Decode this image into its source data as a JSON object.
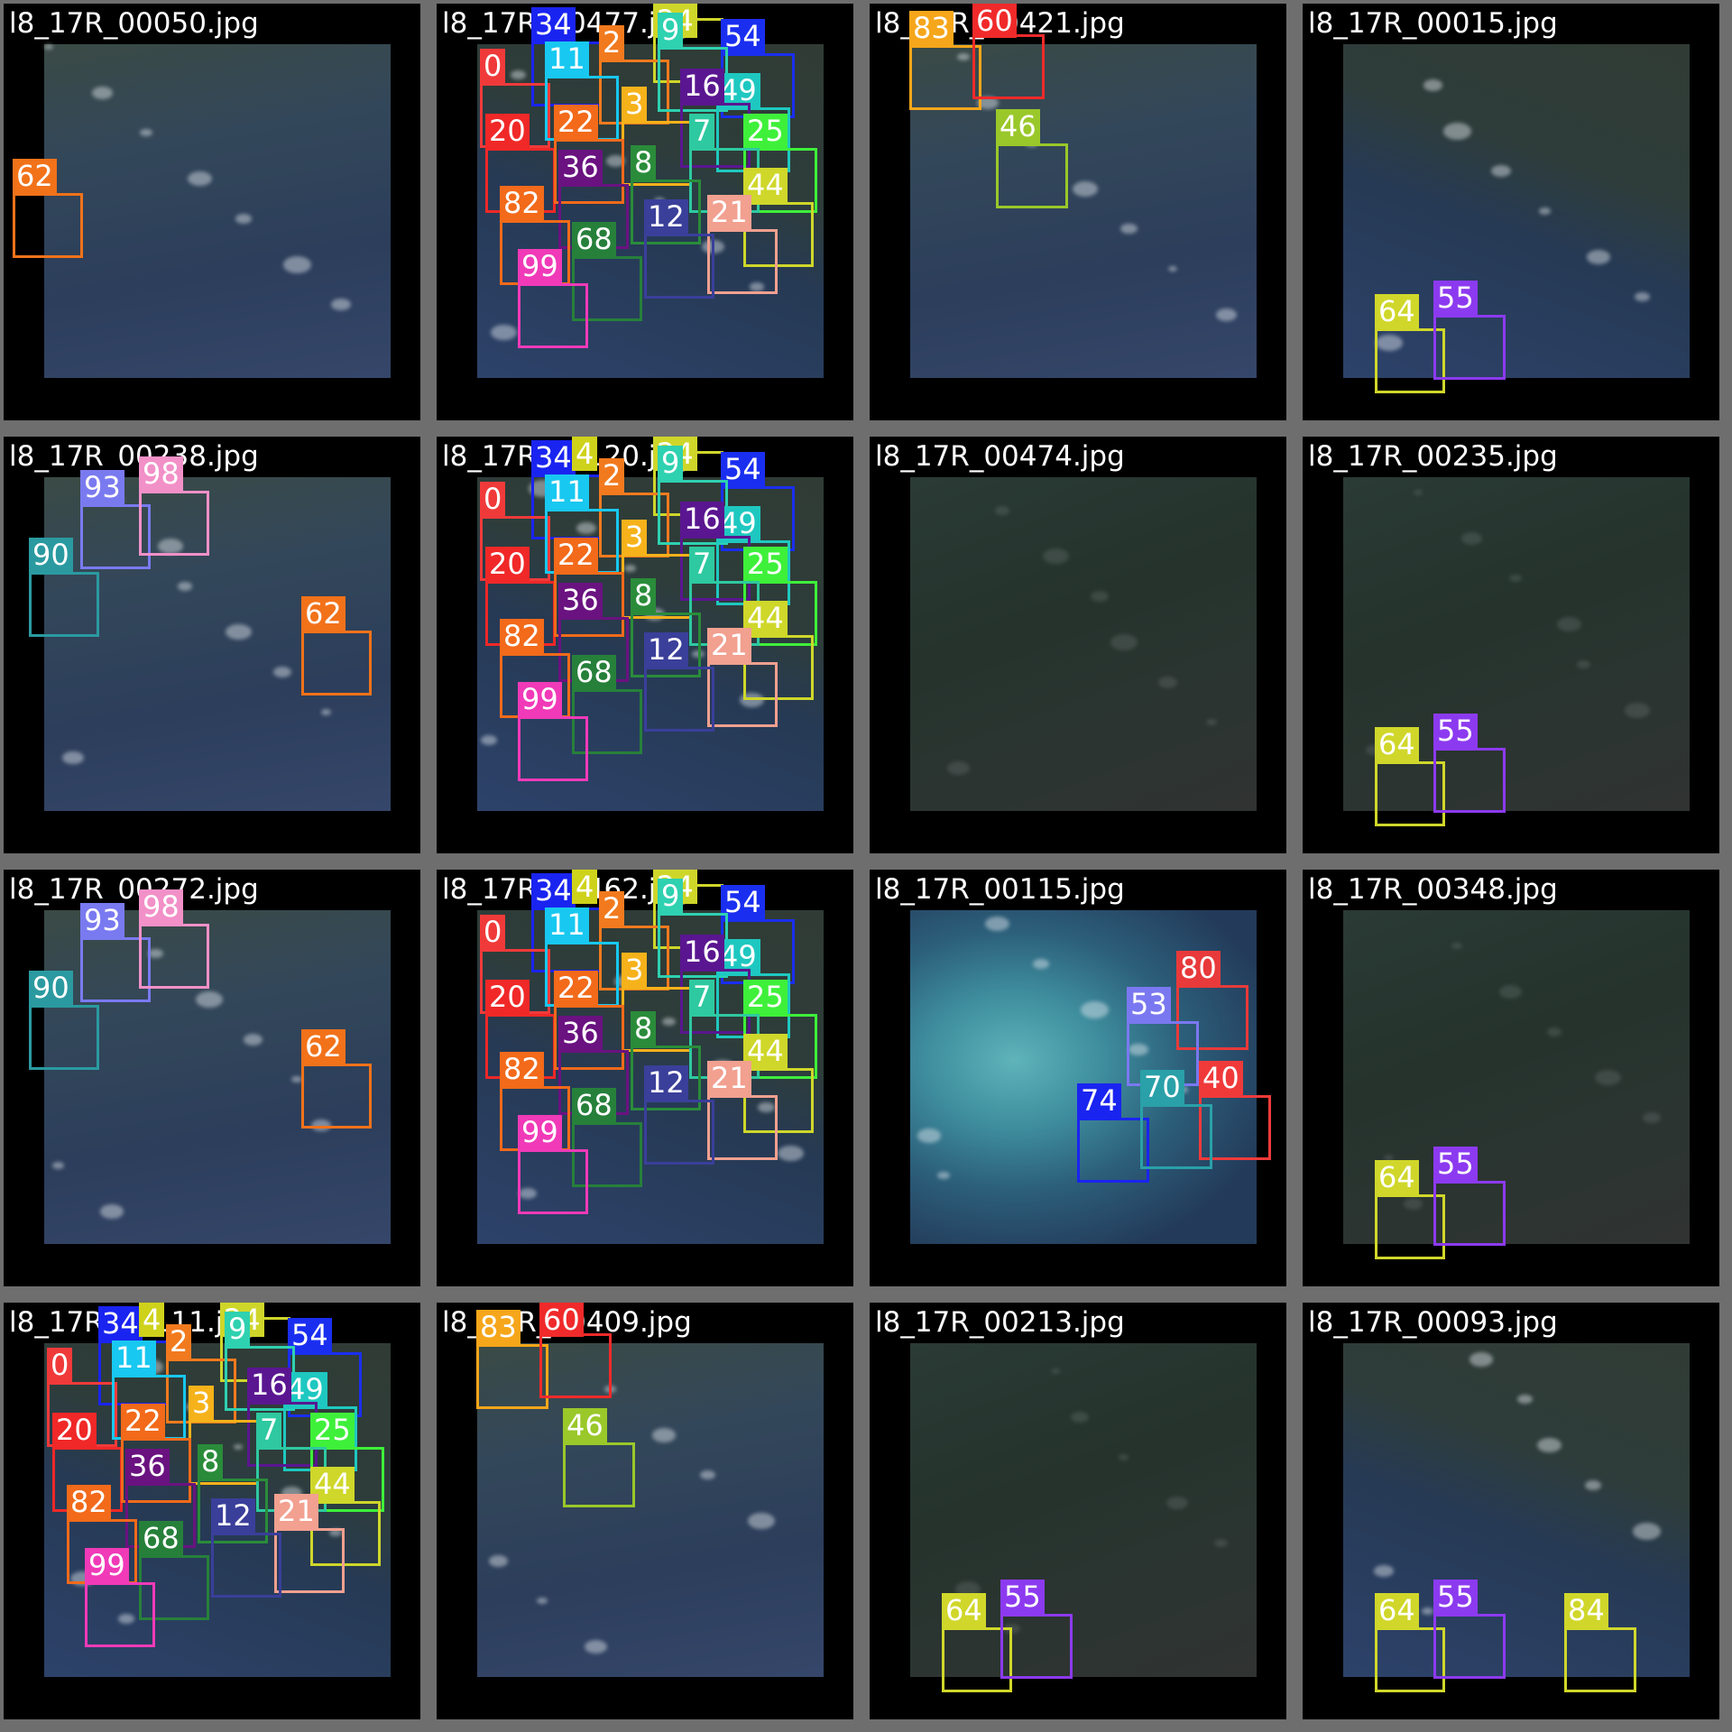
{
  "palette": {
    "0": "#f03a3a",
    "2": "#f27a1e",
    "3": "#f6b21a",
    "4": "#cfd21a",
    "7": "#2ec9a0",
    "8": "#2a8c3a",
    "9": "#2ed1b0",
    "11": "#18c8f0",
    "12": "#3a3f9a",
    "16": "#5a1690",
    "20": "#f02828",
    "21": "#f2a090",
    "22": "#f26a1a",
    "24": "#cfd62a",
    "25": "#3ef03a",
    "34": "#1a24f0",
    "36": "#6a1280",
    "40": "#f03a3a",
    "44": "#cfd72a",
    "46": "#9ac82a",
    "49": "#1ec8c0",
    "53": "#7a78f0",
    "54": "#1a2ef0",
    "55": "#8c3af0",
    "60": "#f02a2a",
    "62": "#f2721a",
    "64": "#d0d72a",
    "68": "#26803a",
    "70": "#2aa0a8",
    "74": "#1a24f0",
    "80": "#e83a3a",
    "82": "#f26a1a",
    "83": "#f6a61a",
    "84": "#d0d72a",
    "90": "#2a9aa0",
    "93": "#7a7af0",
    "98": "#f290c8",
    "99": "#f03ab8"
  },
  "tiles": [
    {
      "filename": "l8_17R_00050.jpg",
      "scene": "sat-sea",
      "boxes": [
        "62"
      ]
    },
    {
      "filename": "l8_17R_00477.jpg",
      "scene": "sat-mixed",
      "boxes": [
        "34",
        "24",
        "54",
        "0",
        "2",
        "11",
        "9",
        "49",
        "16",
        "3",
        "20",
        "22",
        "25",
        "7",
        "36",
        "8",
        "82",
        "44",
        "21",
        "12",
        "68",
        "99"
      ]
    },
    {
      "filename": "l8_17R_00421.jpg",
      "scene": "sat-sea",
      "boxes": [
        "83",
        "60",
        "46"
      ]
    },
    {
      "filename": "l8_17R_00015.jpg",
      "scene": "sat-mixed",
      "boxes": [
        "64",
        "55"
      ]
    },
    {
      "filename": "l8_17R_00238.jpg",
      "scene": "sat-sea",
      "boxes": [
        "93",
        "98",
        "90",
        "62"
      ]
    },
    {
      "filename": "l8_17R_00120.jpg",
      "scene": "sat-mixed",
      "boxes": [
        "34",
        "4",
        "24",
        "54",
        "0",
        "2",
        "11",
        "9",
        "49",
        "16",
        "3",
        "20",
        "22",
        "25",
        "7",
        "36",
        "8",
        "82",
        "44",
        "21",
        "12",
        "68",
        "99"
      ]
    },
    {
      "filename": "l8_17R_00474.jpg",
      "scene": "sat-land",
      "boxes": []
    },
    {
      "filename": "l8_17R_00235.jpg",
      "scene": "sat-land",
      "boxes": [
        "64",
        "55"
      ]
    },
    {
      "filename": "l8_17R_00272.jpg",
      "scene": "sat-sea",
      "boxes": [
        "93",
        "98",
        "90",
        "62"
      ]
    },
    {
      "filename": "l8_17R_00462.jpg",
      "scene": "sat-mixed",
      "boxes": [
        "34",
        "4",
        "24",
        "54",
        "0",
        "2",
        "11",
        "9",
        "49",
        "16",
        "3",
        "20",
        "22",
        "25",
        "7",
        "36",
        "8",
        "82",
        "44",
        "21",
        "12",
        "68",
        "99"
      ]
    },
    {
      "filename": "l8_17R_00115.jpg",
      "scene": "sat-shallow",
      "boxes": [
        "80",
        "53",
        "40",
        "74",
        "70"
      ]
    },
    {
      "filename": "l8_17R_00348.jpg",
      "scene": "sat-land",
      "boxes": [
        "64",
        "55"
      ]
    },
    {
      "filename": "l8_17R_00111.jpg",
      "scene": "sat-mixed",
      "boxes": [
        "34",
        "4",
        "24",
        "54",
        "0",
        "2",
        "11",
        "9",
        "49",
        "16",
        "3",
        "20",
        "22",
        "25",
        "7",
        "36",
        "8",
        "82",
        "44",
        "21",
        "12",
        "68",
        "99"
      ]
    },
    {
      "filename": "l8_17R_00409.jpg",
      "scene": "sat-sea",
      "boxes": [
        "83",
        "60",
        "46"
      ]
    },
    {
      "filename": "l8_17R_00213.jpg",
      "scene": "sat-land",
      "boxes": [
        "64",
        "55"
      ]
    },
    {
      "filename": "l8_17R_00093.jpg",
      "scene": "sat-mixed",
      "boxes": [
        "64",
        "55",
        "84"
      ]
    }
  ]
}
